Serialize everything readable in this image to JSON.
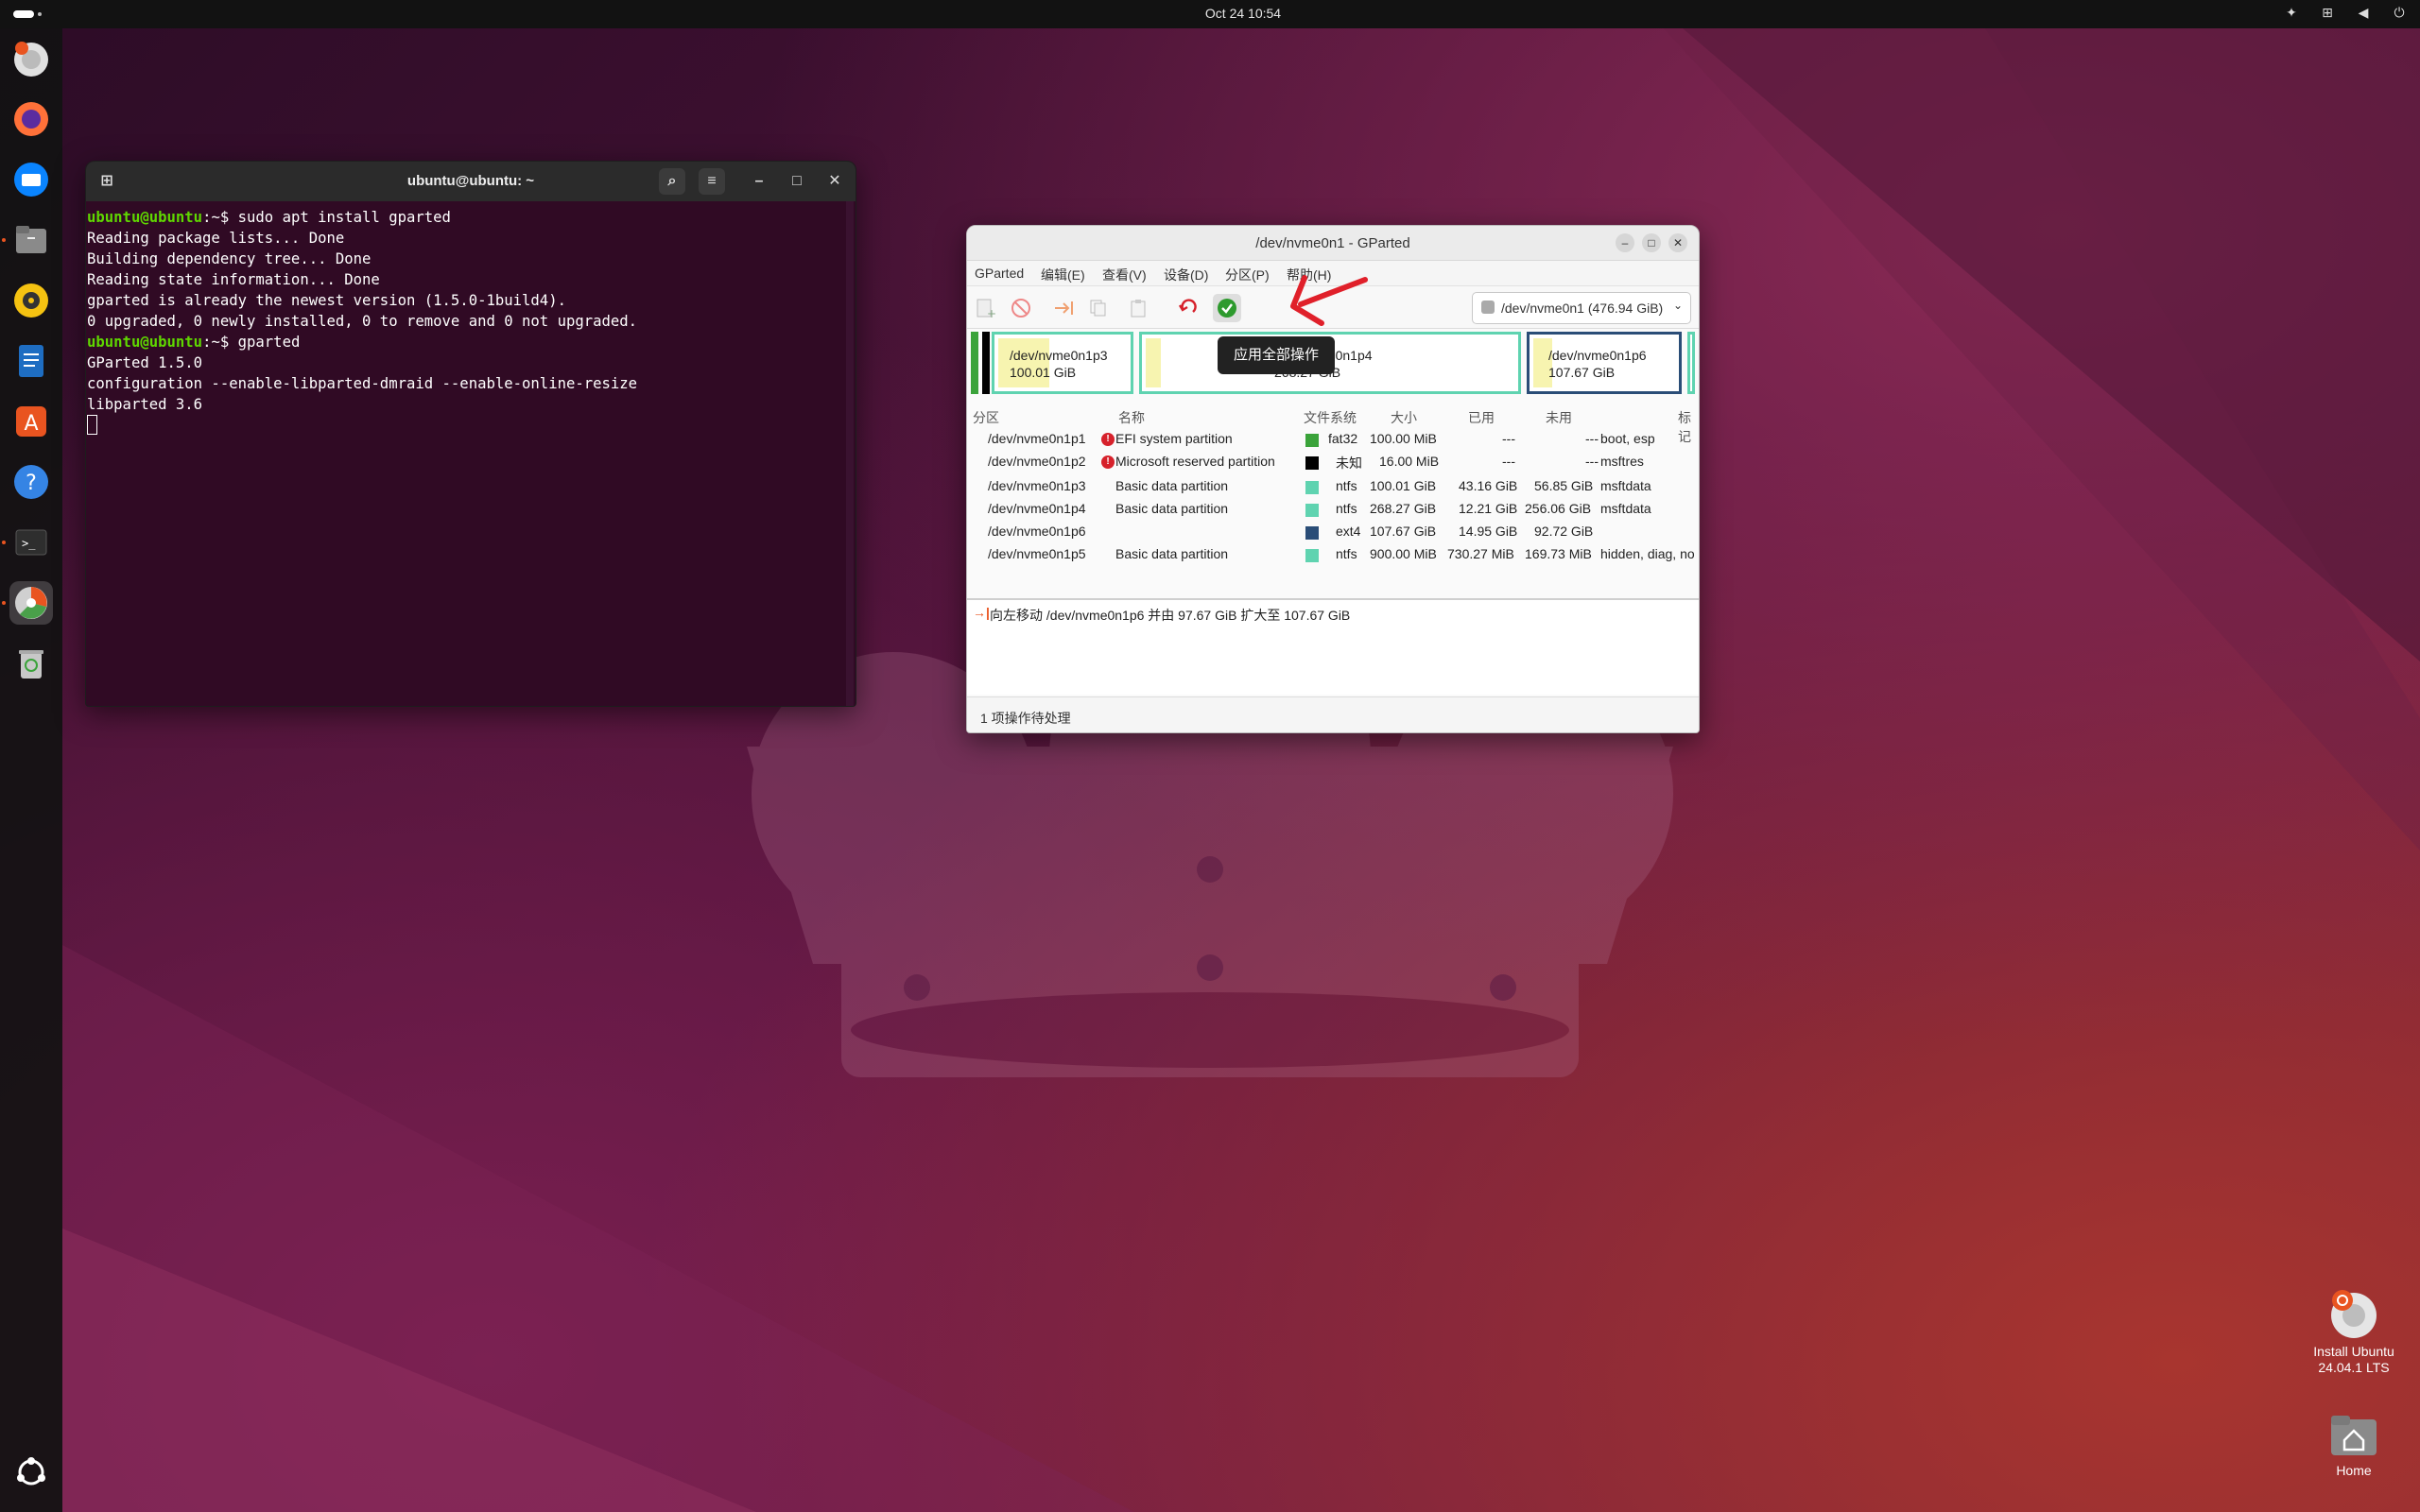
{
  "topbar": {
    "clock": "Oct 24  10:54",
    "tray_icons": [
      "accessibility-icon",
      "network-icon",
      "volume-icon",
      "power-icon"
    ]
  },
  "dock": {
    "items": [
      {
        "name": "installer-icon",
        "color": "#d9d9d9"
      },
      {
        "name": "firefox-icon",
        "color": "#ff7139"
      },
      {
        "name": "thunderbird-icon",
        "color": "#0a84ff"
      },
      {
        "name": "files-icon",
        "color": "#8a8a8a"
      },
      {
        "name": "rhythmbox-icon",
        "color": "#f5c211"
      },
      {
        "name": "writer-icon",
        "color": "#1e6dc2"
      },
      {
        "name": "app-center-icon",
        "color": "#e95420"
      },
      {
        "name": "help-icon",
        "color": "#3584e4"
      },
      {
        "name": "terminal-icon",
        "color": "#2e2e2e"
      },
      {
        "name": "gparted-icon",
        "color": "#c7c7c7"
      },
      {
        "name": "trash-icon",
        "color": "#bdbdbd"
      }
    ],
    "apps_grid_icon": "show-apps-icon"
  },
  "terminal": {
    "title": "ubuntu@ubuntu: ~",
    "prompt_user": "ubuntu@ubuntu",
    "prompt_sep": ":~$ ",
    "lines": {
      "l1_cmd": "sudo apt install gparted",
      "l2": "Reading package lists... Done",
      "l3": "Building dependency tree... Done",
      "l4": "Reading state information... Done",
      "l5": "gparted is already the newest version (1.5.0-1build4).",
      "l6": "0 upgraded, 0 newly installed, 0 to remove and 0 not upgraded.",
      "l7_cmd": "gparted",
      "l8": "GParted 1.5.0",
      "l9": "configuration --enable-libparted-dmraid --enable-online-resize",
      "l10": "libparted 3.6"
    }
  },
  "gparted": {
    "title": "/dev/nvme0n1 - GParted",
    "menu": [
      "GParted",
      "编辑(E)",
      "查看(V)",
      "设备(D)",
      "分区(P)",
      "帮助(H)"
    ],
    "device": "/dev/nvme0n1 (476.94 GiB)",
    "tooltip": "应用全部操作",
    "map": {
      "p3_name": "/dev/nvme0n1p3",
      "p3_size": "100.01 GiB",
      "p4_name": "/dev/nvme0n1p4",
      "p4_size": "268.27 GiB",
      "p6_name": "/dev/nvme0n1p6",
      "p6_size": "107.67 GiB"
    },
    "columns": [
      "分区",
      "名称",
      "文件系统",
      "大小",
      "已用",
      "未用",
      "标记"
    ],
    "rows": [
      {
        "partition": "/dev/nvme0n1p1",
        "warn": true,
        "name": "EFI system partition",
        "fs": "fat32",
        "color": "#3aa33a",
        "size": "100.00 MiB",
        "used": "---",
        "unused": "---",
        "flags": "boot, esp"
      },
      {
        "partition": "/dev/nvme0n1p2",
        "warn": true,
        "name": "Microsoft reserved partition",
        "fs": "未知",
        "color": "#000000",
        "size": "16.00 MiB",
        "used": "---",
        "unused": "---",
        "flags": "msftres"
      },
      {
        "partition": "/dev/nvme0n1p3",
        "warn": false,
        "name": "Basic data partition",
        "fs": "ntfs",
        "color": "#5fd3b0",
        "size": "100.01 GiB",
        "used": "43.16 GiB",
        "unused": "56.85 GiB",
        "flags": "msftdata"
      },
      {
        "partition": "/dev/nvme0n1p4",
        "warn": false,
        "name": "Basic data partition",
        "fs": "ntfs",
        "color": "#5fd3b0",
        "size": "268.27 GiB",
        "used": "12.21 GiB",
        "unused": "256.06 GiB",
        "flags": "msftdata"
      },
      {
        "partition": "/dev/nvme0n1p6",
        "warn": false,
        "name": "",
        "fs": "ext4",
        "color": "#2a4d77",
        "size": "107.67 GiB",
        "used": "14.95 GiB",
        "unused": "92.72 GiB",
        "flags": ""
      },
      {
        "partition": "/dev/nvme0n1p5",
        "warn": false,
        "name": "Basic data partition",
        "fs": "ntfs",
        "color": "#5fd3b0",
        "size": "900.00 MiB",
        "used": "730.27 MiB",
        "unused": "169.73 MiB",
        "flags": "hidden, diag, no"
      }
    ],
    "pending_op": "向左移动 /dev/nvme0n1p6 并由 97.67 GiB 扩大至 107.67 GiB",
    "status": "1 项操作待处理"
  },
  "desktop": {
    "install_label_1": "Install Ubuntu",
    "install_label_2": "24.04.1 LTS",
    "home_label": "Home"
  }
}
